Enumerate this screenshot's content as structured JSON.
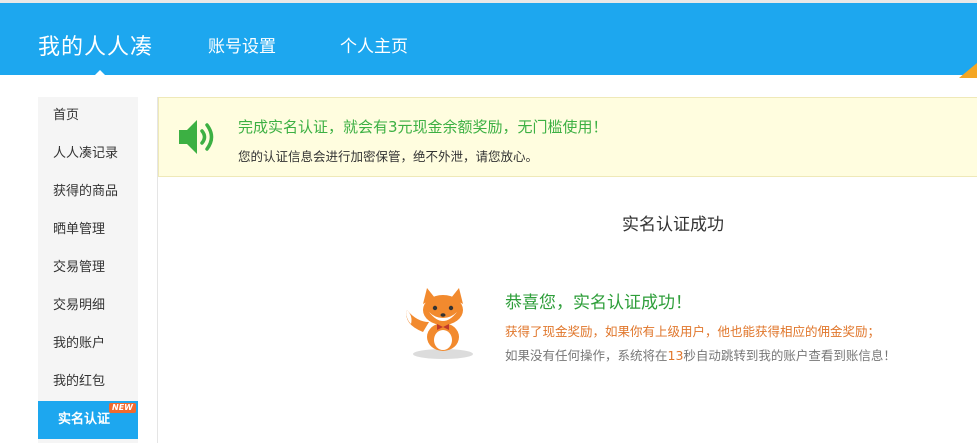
{
  "header": {
    "brand": "我的人人凑",
    "nav": [
      {
        "label": "账号设置"
      },
      {
        "label": "个人主页"
      }
    ]
  },
  "sidebar": {
    "items": [
      {
        "label": "首页"
      },
      {
        "label": "人人凑记录"
      },
      {
        "label": "获得的商品"
      },
      {
        "label": "晒单管理"
      },
      {
        "label": "交易管理"
      },
      {
        "label": "交易明细"
      },
      {
        "label": "我的账户"
      },
      {
        "label": "我的红包"
      },
      {
        "label": "实名认证",
        "active": true,
        "badge": "NEW"
      }
    ]
  },
  "notice": {
    "main": "完成实名认证，就会有3元现金余额奖励，无门槛使用！",
    "sub": "您的认证信息会进行加密保管，绝不外泄，请您放心。"
  },
  "result": {
    "title": "实名认证成功",
    "success_title": "恭喜您，实名认证成功！",
    "reward_text": "获得了现金奖励，如果你有上级用户，他也能获得相应的佣金奖励；",
    "redirect_before": "如果没有任何操作，系统将在",
    "countdown": "13",
    "redirect_after": "秒自动跳转到我的账户查看到账信息！"
  },
  "colors": {
    "header_bg": "#1da7ef",
    "notice_bg": "#fffddf",
    "success_green": "#2e9e3a",
    "notice_green": "#3cb043",
    "accent_orange": "#e0762b",
    "badge": "#f26a2e"
  },
  "icons": {
    "speaker": "speaker-icon",
    "mascot": "fox-mascot-icon"
  }
}
